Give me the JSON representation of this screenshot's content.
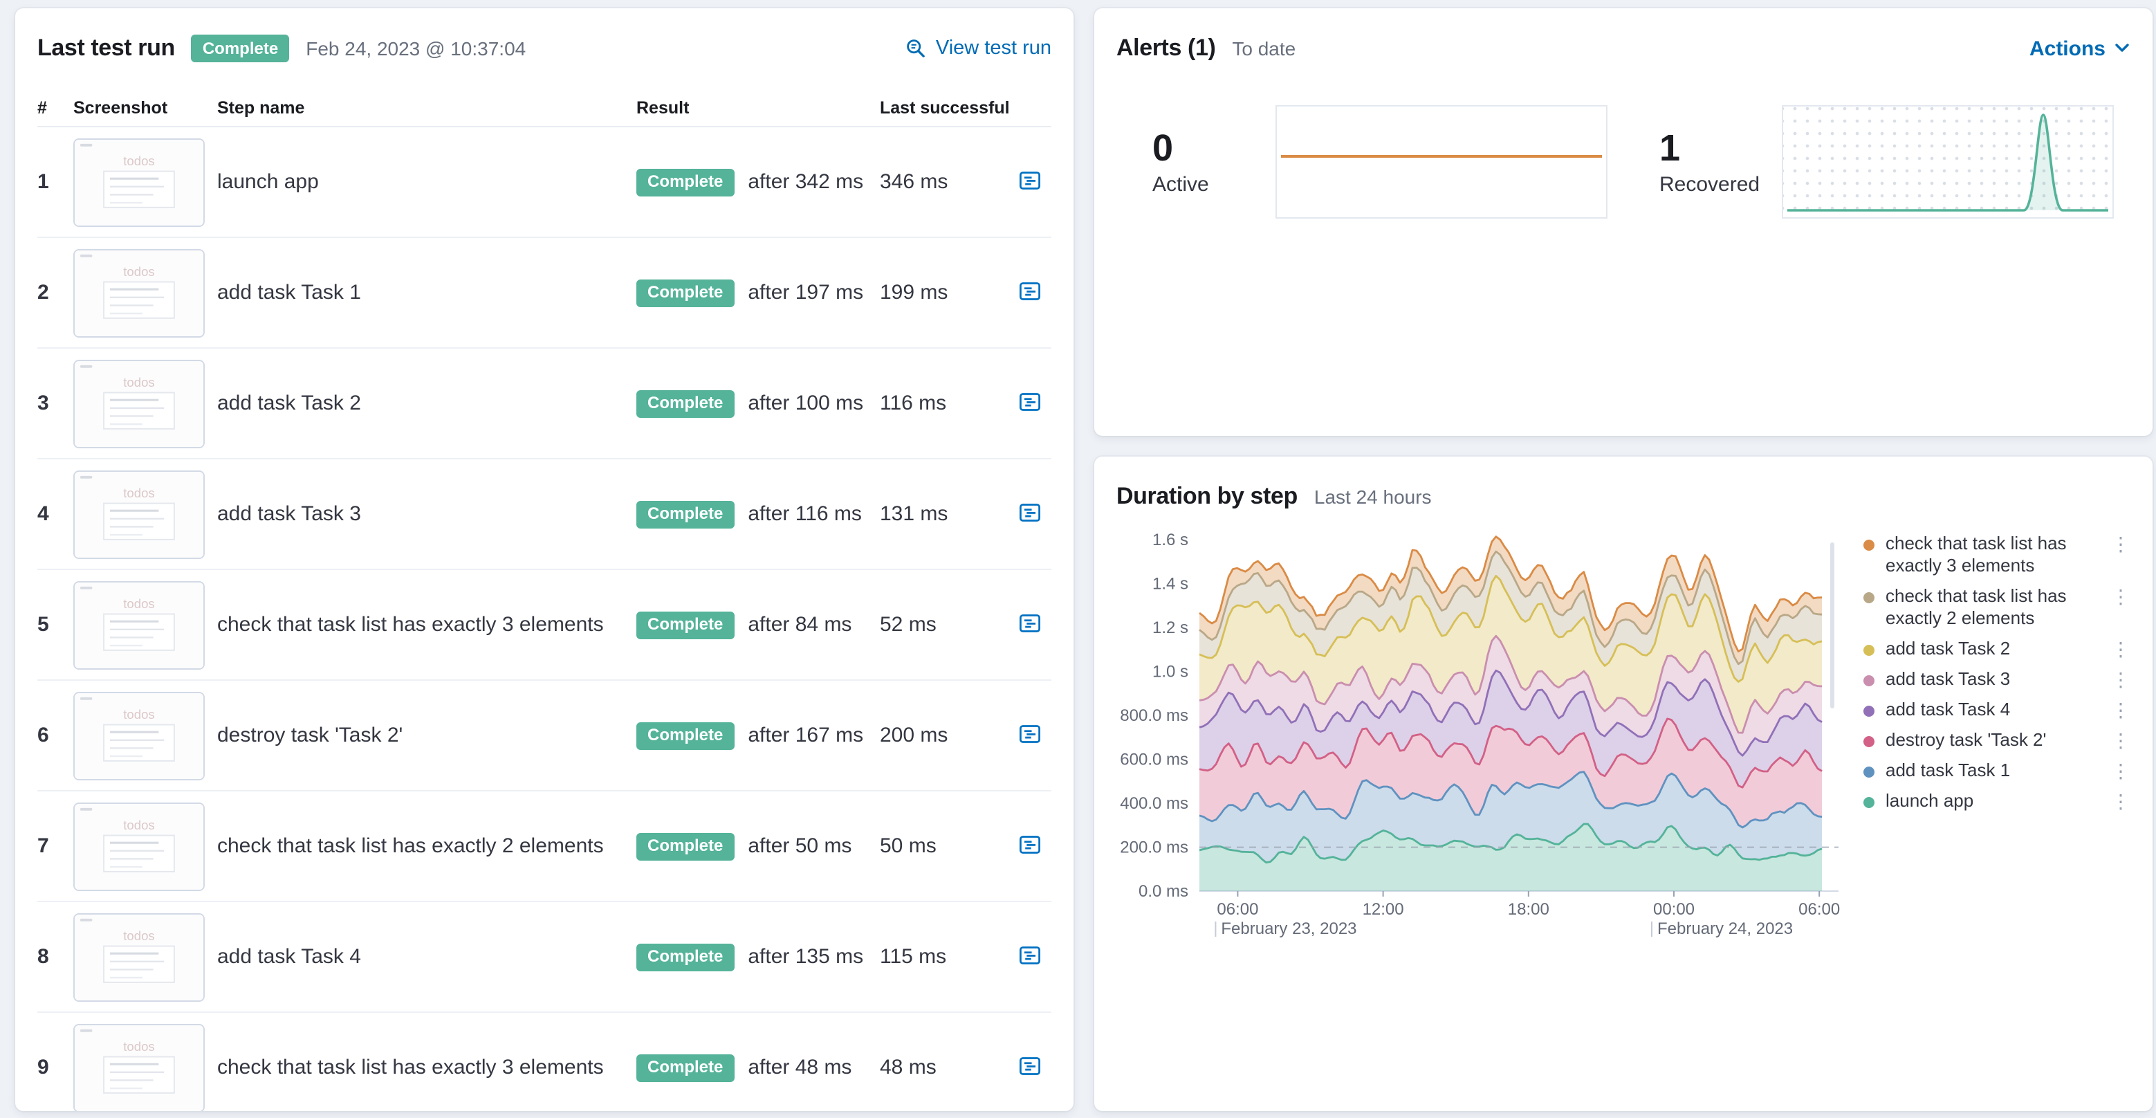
{
  "colors": {
    "badge_green": "#54B399",
    "link_blue": "#006BB4",
    "row_icon_blue": "#0071C2"
  },
  "last_test_run": {
    "title": "Last test run",
    "status_badge": "Complete",
    "timestamp": "Feb 24, 2023 @ 10:37:04",
    "view_link": "View test run",
    "thumb_label": "todos",
    "columns": {
      "num": "#",
      "screenshot": "Screenshot",
      "step": "Step name",
      "result": "Result",
      "last_successful": "Last successful"
    },
    "rows": [
      {
        "num": "1",
        "step": "launch app",
        "badge": "Complete",
        "after": "after 342 ms",
        "last": "346 ms"
      },
      {
        "num": "2",
        "step": "add task Task 1",
        "badge": "Complete",
        "after": "after 197 ms",
        "last": "199 ms"
      },
      {
        "num": "3",
        "step": "add task Task 2",
        "badge": "Complete",
        "after": "after 100 ms",
        "last": "116 ms"
      },
      {
        "num": "4",
        "step": "add task Task 3",
        "badge": "Complete",
        "after": "after 116 ms",
        "last": "131 ms"
      },
      {
        "num": "5",
        "step": "check that task list has exactly 3 elements",
        "badge": "Complete",
        "after": "after 84 ms",
        "last": "52 ms"
      },
      {
        "num": "6",
        "step": "destroy task 'Task 2'",
        "badge": "Complete",
        "after": "after 167 ms",
        "last": "200 ms"
      },
      {
        "num": "7",
        "step": "check that task list has exactly 2 elements",
        "badge": "Complete",
        "after": "after 50 ms",
        "last": "50 ms"
      },
      {
        "num": "8",
        "step": "add task Task 4",
        "badge": "Complete",
        "after": "after 135 ms",
        "last": "115 ms"
      },
      {
        "num": "9",
        "step": "check that task list has exactly 3 elements",
        "badge": "Complete",
        "after": "after 48 ms",
        "last": "48 ms"
      }
    ]
  },
  "alerts": {
    "title": "Alerts (1)",
    "subtitle": "To date",
    "actions_label": "Actions",
    "stats": [
      {
        "value": "0",
        "label": "Active",
        "type": "flat",
        "color": "#DA8B45"
      },
      {
        "value": "1",
        "label": "Recovered",
        "type": "spike",
        "color": "#54B399"
      }
    ]
  },
  "chart_data": {
    "type": "area",
    "stacked": true,
    "title": "Duration by step",
    "subtitle": "Last 24 hours",
    "legend_position": "right",
    "ylim_ms": [
      0,
      1600
    ],
    "y_ticks": [
      {
        "label": "1.6 s",
        "ms": 1600
      },
      {
        "label": "1.4 s",
        "ms": 1400
      },
      {
        "label": "1.2 s",
        "ms": 1200
      },
      {
        "label": "1.0 s",
        "ms": 1000
      },
      {
        "label": "800.0 ms",
        "ms": 800
      },
      {
        "label": "600.0 ms",
        "ms": 600
      },
      {
        "label": "400.0 ms",
        "ms": 400
      },
      {
        "label": "200.0 ms",
        "ms": 200
      },
      {
        "label": "0.0 ms",
        "ms": 0
      }
    ],
    "x_ticks": [
      "06:00",
      "12:00",
      "18:00",
      "00:00",
      "06:00"
    ],
    "x_dates": [
      {
        "label": "February 23, 2023",
        "tick_index": 0
      },
      {
        "label": "February 24, 2023",
        "tick_index": 3
      }
    ],
    "series_bottom_to_top": [
      {
        "name": "launch app",
        "color": "#54B399",
        "avg_ms": 195
      },
      {
        "name": "add task Task 1",
        "color": "#6092C0",
        "avg_ms": 195
      },
      {
        "name": "destroy task 'Task 2'",
        "color": "#D36086",
        "avg_ms": 195
      },
      {
        "name": "add task Task 4",
        "color": "#9170B8",
        "avg_ms": 185
      },
      {
        "name": "add task Task 3",
        "color": "#CA8EAE",
        "avg_ms": 125
      },
      {
        "name": "add task Task 2",
        "color": "#D6BF57",
        "avg_ms": 235
      },
      {
        "name": "check that task list has exactly 2 elements",
        "color": "#B9A888",
        "avg_ms": 105
      },
      {
        "name": "check that task list has exactly 3 elements",
        "color": "#DA8B45",
        "avg_ms": 65
      }
    ]
  }
}
